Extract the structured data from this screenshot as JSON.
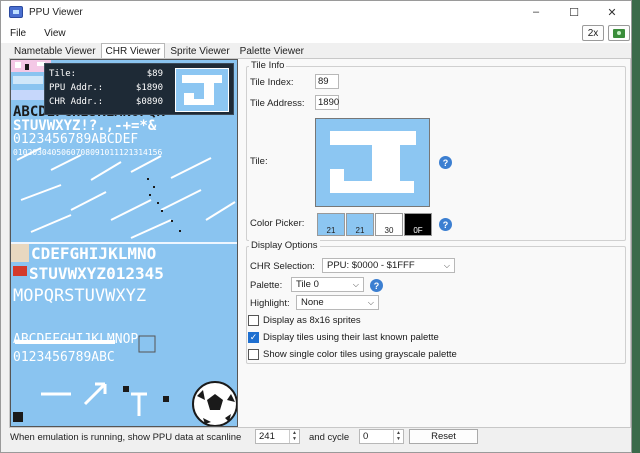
{
  "window": {
    "title": "PPU Viewer",
    "controls": [
      "–",
      "☐",
      "✕"
    ]
  },
  "menu": {
    "items": [
      "File",
      "View"
    ]
  },
  "toolbar": {
    "zoom_label": "2x",
    "snapshot_icon": "camera-icon"
  },
  "tabs": [
    {
      "label": "Nametable Viewer",
      "active": false
    },
    {
      "label": "CHR Viewer",
      "active": true
    },
    {
      "label": "Sprite Viewer",
      "active": false
    },
    {
      "label": "Palette Viewer",
      "active": false
    }
  ],
  "chr_view": {
    "top_rows": [
      "ABCDEFGHIJKLMNOPQR",
      "STUVWXYZ!?.,-+=*&",
      "0123456789ABCDEF",
      "0102030405060708091011121314156"
    ],
    "bottom_rows": [
      "CDEFGHIJKLMNO",
      "STUVWXYZ012345",
      "MOPQRSTUVWXYZ",
      "ABCDEFGHIJKLMNOP",
      "0123456789ABC"
    ],
    "colors": {
      "background": "#8ac4f0",
      "tile_light": "#ffffff",
      "tile_dark": "#1a1a1a",
      "accent_red": "#d43a2a",
      "accent_yellow": "#f0d060"
    }
  },
  "tooltip": {
    "tile_label": "Tile:",
    "tile_value": "$89",
    "ppu_addr_label": "PPU Addr.:",
    "ppu_addr_value": "$1890",
    "chr_addr_label": "CHR Addr.:",
    "chr_addr_value": "$0890"
  },
  "tile_info": {
    "group_title": "Tile Info",
    "tile_index_label": "Tile Index:",
    "tile_index_value": "89",
    "tile_address_label": "Tile Address:",
    "tile_address_value": "1890",
    "tile_label": "Tile:",
    "color_picker_label": "Color Picker:",
    "swatches": [
      {
        "label": "21",
        "color": "#8cc6f2"
      },
      {
        "label": "21",
        "color": "#8cc6f2"
      },
      {
        "label": "30",
        "color": "#ffffff"
      },
      {
        "label": "0F",
        "color": "#000000"
      }
    ],
    "help_symbol": "?"
  },
  "display_options": {
    "group_title": "Display Options",
    "chr_selection_label": "CHR Selection:",
    "chr_selection_value": "PPU: $0000 - $1FFF",
    "palette_label": "Palette:",
    "palette_value": "Tile 0",
    "highlight_label": "Highlight:",
    "highlight_value": "None",
    "checkboxes": [
      {
        "label": "Display as 8x16 sprites",
        "checked": false
      },
      {
        "label": "Display tiles using their last known palette",
        "checked": true
      },
      {
        "label": "Show single color tiles using grayscale palette",
        "checked": false
      }
    ]
  },
  "bottom": {
    "scanline_label": "When emulation is running, show PPU data at scanline",
    "scanline_value": "241",
    "cycle_label": "and cycle",
    "cycle_value": "0",
    "reset_label": "Reset"
  }
}
